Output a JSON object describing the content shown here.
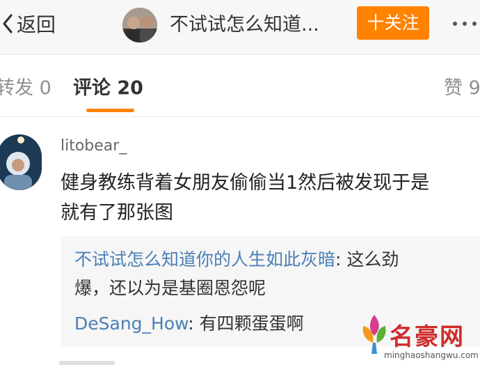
{
  "header": {
    "back_label": "返回",
    "title": "不试试怎么知道...",
    "follow_label": "十关注",
    "accent": "#ff8200"
  },
  "tabs": {
    "repost_label": "转发 0",
    "comments_label": "评论 20",
    "likes_label": "赞 9"
  },
  "comment": {
    "username": "litobear_",
    "text_line1": "健身教练背着女朋友偷偷当1然后被发现于是",
    "text_line2": "就有了那张图",
    "replies": [
      {
        "user": "不试试怎么知道你的人生如此灰暗",
        "text_line1": ": 这么劲",
        "text_line2": "爆，还以为是基圈恩怨呢"
      },
      {
        "user": "DeSang_How",
        "text": ": 有四颗蛋蛋啊"
      }
    ]
  },
  "watermark": {
    "title": "名豪网",
    "url": "minghaoshangwu.com"
  },
  "colors": {
    "link_blue": "#4a7fb5",
    "reply_bg": "#f6f6f6"
  },
  "icons": [
    "chevron-left-icon",
    "more-dots-icon",
    "watermark-logo-icon"
  ]
}
